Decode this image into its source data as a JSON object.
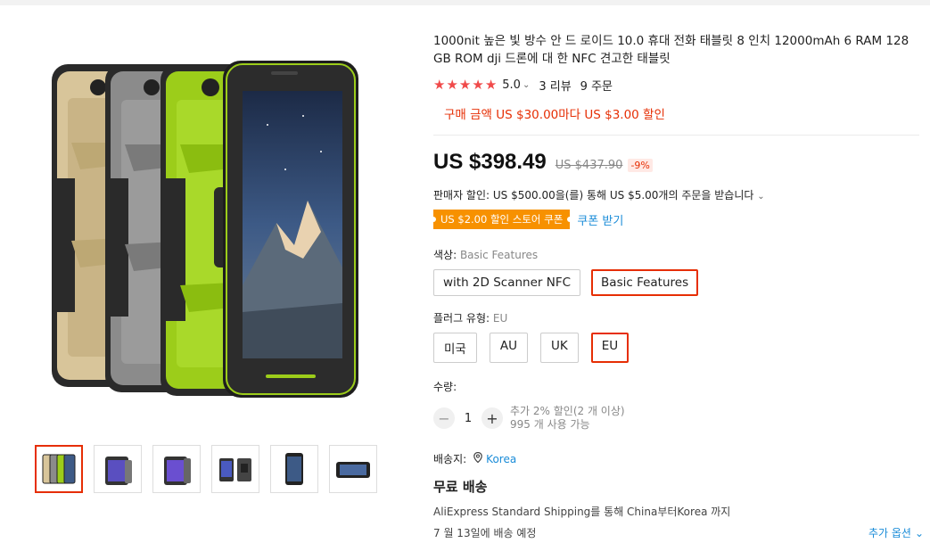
{
  "product": {
    "title": "1000nit 높은 빛 방수 안 드 로이드 10.0 휴대 전화 태블릿 8 인치 12000mAh 6 RAM 128 GB ROM dji 드론에 대 한 NFC 견고한 태블릿",
    "rating": {
      "score": "5.0",
      "stars": 5,
      "reviews": "3 리뷰",
      "orders": "9 주문"
    },
    "promo": "구매 금액 US $30.00마다 US $3.00 할인",
    "price": "US $398.49",
    "old_price": "US $437.90",
    "discount": "-9%",
    "seller_discount": "판매자 할인: US $500.00을(를) 통해 US $5.00개의 주문을 받습니다",
    "coupon": {
      "badge": "US $2.00 할인 스토어 쿠폰",
      "link": "쿠폰 받기"
    }
  },
  "sku": {
    "color": {
      "label": "색상:",
      "selected": "Basic Features",
      "options": [
        "with 2D Scanner NFC",
        "Basic Features"
      ]
    },
    "plug": {
      "label": "플러그 유형:",
      "selected": "EU",
      "options": [
        "미국",
        "AU",
        "UK",
        "EU"
      ]
    }
  },
  "quantity": {
    "label": "수량:",
    "value": "1",
    "minus": "−",
    "plus": "+",
    "note_line1": "추가 2% 할인(2 개 이상)",
    "note_line2": "995 개 사용 가능"
  },
  "shipping": {
    "to_label": "배송지:",
    "country": "Korea",
    "free": "무료 배송",
    "method": "AliExpress Standard Shipping를 통해 China부터Korea 까지",
    "delivery": "7 월 13일에 배송 예정",
    "more_options": "추가 옵션"
  },
  "gallery": {
    "thumbs": [
      "thumb-1",
      "thumb-2",
      "thumb-3",
      "thumb-4",
      "thumb-5",
      "thumb-6"
    ]
  },
  "colors": {
    "accent": "#e62e04",
    "star": "#f04a4a",
    "coupon": "#f79100",
    "link": "#1a8cd8",
    "phone_green": "#9ccd1a",
    "phone_gold": "#d8c59a",
    "phone_gray": "#8b8b8b"
  }
}
